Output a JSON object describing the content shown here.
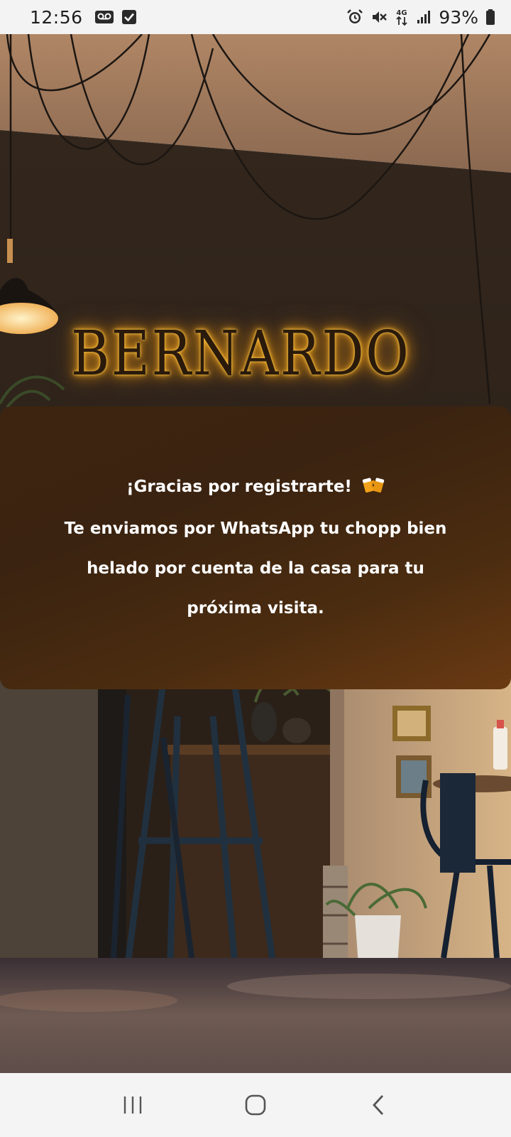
{
  "status_bar": {
    "time": "12:56",
    "battery_percent": "93%",
    "left_icons": [
      "voicemail-icon",
      "checkbox-icon"
    ],
    "right_icons": [
      "alarm-icon",
      "mute-icon",
      "4g-icon",
      "signal-icon",
      "battery-icon"
    ],
    "network": "4G"
  },
  "hero": {
    "sign_text": "BERNARDO"
  },
  "card": {
    "title": "¡Gracias por registrarte!",
    "title_icon": "beer-mugs-icon",
    "body": "Te enviamos por WhatsApp tu chopp bien helado por cuenta de la casa para tu próxima visita."
  },
  "nav_bar": {
    "buttons": [
      "recent-apps",
      "home",
      "back"
    ]
  },
  "colors": {
    "card_start": "#3d2410",
    "card_end": "#6a3a12",
    "sign_glow": "#ffb326",
    "status_bar_bg": "#f3f3f3"
  }
}
